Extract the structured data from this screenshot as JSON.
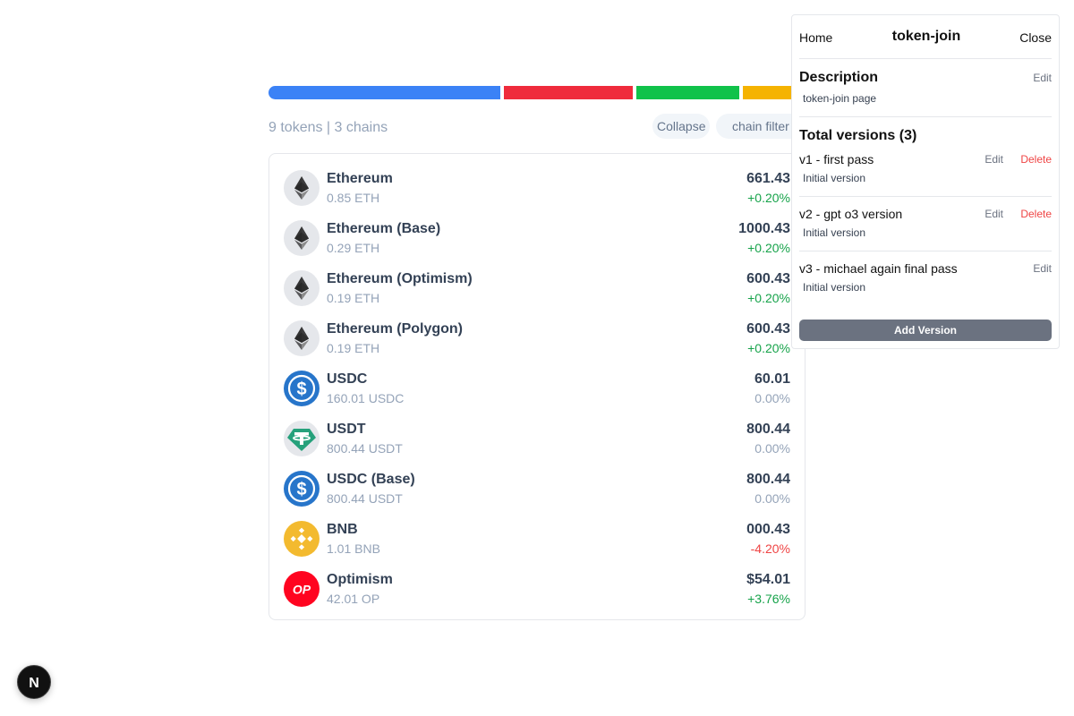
{
  "distribution": {
    "segments": [
      {
        "color": "#3b82f6",
        "share": 0.44
      },
      {
        "color": "#ef2b3c",
        "share": 0.245
      },
      {
        "color": "#10c24a",
        "share": 0.195
      },
      {
        "color": "#f5b301",
        "share": 0.1
      }
    ]
  },
  "summary": {
    "text": "9 tokens | 3 chains"
  },
  "controls": {
    "collapse_label": "Collapse",
    "filter_label": "chain filter"
  },
  "tokens": [
    {
      "name": "Ethereum",
      "amount": "0.85 ETH",
      "value": "661.43",
      "change": "+0.20%",
      "trend": "up",
      "icon": "ethereum-icon"
    },
    {
      "name": "Ethereum (Base)",
      "amount": "0.29 ETH",
      "value": "1000.43",
      "change": "+0.20%",
      "trend": "up",
      "icon": "ethereum-icon"
    },
    {
      "name": "Ethereum (Optimism)",
      "amount": "0.19 ETH",
      "value": "600.43",
      "change": "+0.20%",
      "trend": "up",
      "icon": "ethereum-icon"
    },
    {
      "name": "Ethereum (Polygon)",
      "amount": "0.19 ETH",
      "value": "600.43",
      "change": "+0.20%",
      "trend": "up",
      "icon": "ethereum-icon"
    },
    {
      "name": "USDC",
      "amount": "160.01 USDC",
      "value": "60.01",
      "change": "0.00%",
      "trend": "flat",
      "icon": "usdc-icon"
    },
    {
      "name": "USDT",
      "amount": "800.44 USDT",
      "value": "800.44",
      "change": "0.00%",
      "trend": "flat",
      "icon": "usdt-icon"
    },
    {
      "name": "USDC (Base)",
      "amount": "800.44 USDT",
      "value": "800.44",
      "change": "0.00%",
      "trend": "flat",
      "icon": "usdc-icon"
    },
    {
      "name": "BNB",
      "amount": "1.01 BNB",
      "value": "000.43",
      "change": "-4.20%",
      "trend": "down",
      "icon": "bnb-icon"
    },
    {
      "name": "Optimism",
      "amount": "42.01 OP",
      "value": "$54.01",
      "change": "+3.76%",
      "trend": "up",
      "icon": "optimism-icon"
    }
  ],
  "colors": {
    "up": "#16a34a",
    "down": "#ef4444",
    "flat": "#94a3b8"
  },
  "panel": {
    "home_label": "Home",
    "title": "token-join",
    "close_label": "Close",
    "description_heading": "Description",
    "description_edit": "Edit",
    "description_text": "token-join page",
    "versions_heading": "Total versions (3)",
    "versions": [
      {
        "name": "v1 - first pass",
        "note": "Initial version",
        "edit": "Edit",
        "delete": "Delete"
      },
      {
        "name": "v2 - gpt o3 version",
        "note": "Initial version",
        "edit": "Edit",
        "delete": "Delete"
      },
      {
        "name": "v3 - michael again final pass",
        "note": "Initial version",
        "edit": "Edit"
      }
    ],
    "add_label": "Add Version"
  },
  "badge": {
    "letter": "N"
  }
}
